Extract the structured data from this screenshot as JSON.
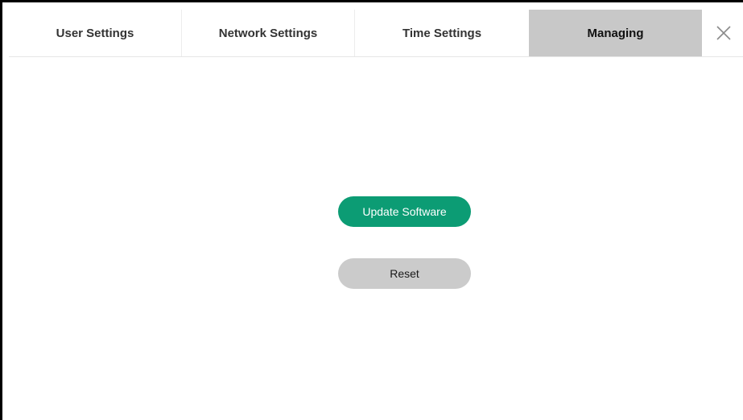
{
  "tabs": [
    {
      "label": "User Settings",
      "active": false
    },
    {
      "label": "Network Settings",
      "active": false
    },
    {
      "label": "Time Settings",
      "active": false
    },
    {
      "label": "Managing",
      "active": true
    }
  ],
  "close": {
    "icon": "close-icon"
  },
  "actions": {
    "update_label": "Update Software",
    "reset_label": "Reset"
  },
  "colors": {
    "active_tab_bg": "#c8c8c8",
    "primary_button": "#0c9c74",
    "secondary_button": "#cbcbcb"
  }
}
